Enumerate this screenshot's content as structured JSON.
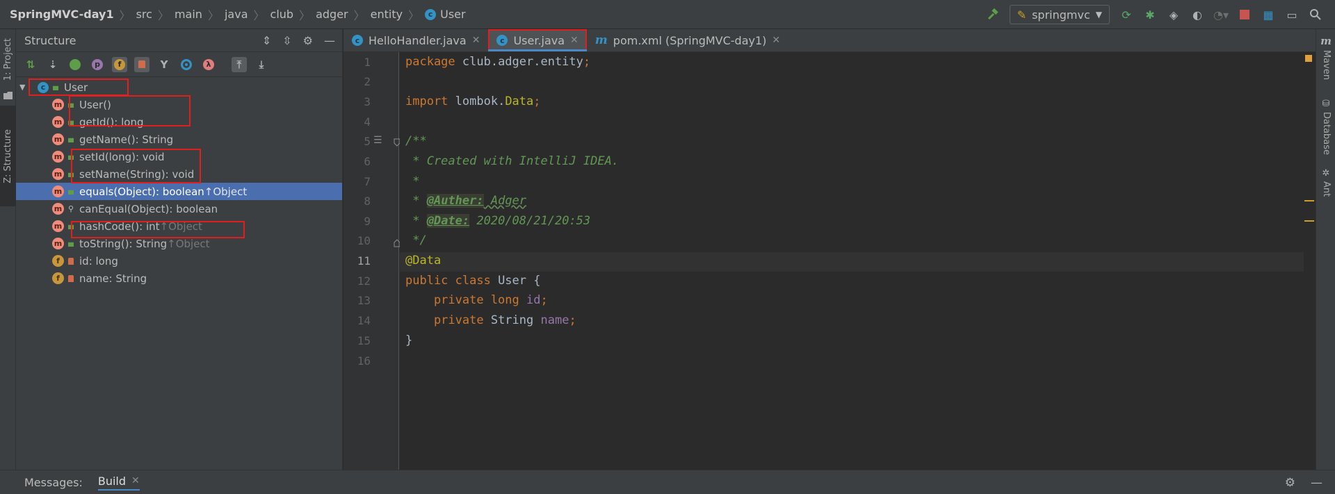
{
  "breadcrumb": {
    "items": [
      "SpringMVC-day1",
      "src",
      "main",
      "java",
      "club",
      "adger",
      "entity",
      "User"
    ],
    "class_badge": "c"
  },
  "toolbar": {
    "run_config_label": "springmvc",
    "icons": [
      "hammer-icon",
      "run-config-dropdown",
      "rerun-icon",
      "debug-icon",
      "coverage-icon",
      "profile-icon",
      "stop-icon",
      "project-structure-icon",
      "layout-icon",
      "search-everywhere-icon"
    ]
  },
  "left_strip": {
    "project_label": "1: Project",
    "structure_label": "Z: Structure"
  },
  "structure_panel": {
    "title": "Structure",
    "toolbar_badges": {
      "f": "f",
      "p": "p",
      "lambda": "λ",
      "anon": "a"
    },
    "root": {
      "badge": "c",
      "label": "User"
    },
    "method_badge": "m",
    "field_badge": "f",
    "items": [
      {
        "kind": "method",
        "vis": "public",
        "label": "User()",
        "inherited": ""
      },
      {
        "kind": "method",
        "vis": "public",
        "label": "getId(): long",
        "inherited": ""
      },
      {
        "kind": "method",
        "vis": "public",
        "label": "getName(): String",
        "inherited": ""
      },
      {
        "kind": "method",
        "vis": "public",
        "label": "setId(long): void",
        "inherited": ""
      },
      {
        "kind": "method",
        "vis": "public",
        "label": "setName(String): void",
        "inherited": ""
      },
      {
        "kind": "method",
        "vis": "public",
        "label": "equals(Object): boolean ",
        "inherited": "↑Object"
      },
      {
        "kind": "method",
        "vis": "package",
        "label": "canEqual(Object): boolean",
        "inherited": ""
      },
      {
        "kind": "method",
        "vis": "public",
        "label": "hashCode(): int ",
        "inherited": "↑Object"
      },
      {
        "kind": "method",
        "vis": "public",
        "label": "toString(): String ",
        "inherited": "↑Object"
      },
      {
        "kind": "field",
        "vis": "private",
        "label": "id: long",
        "inherited": ""
      },
      {
        "kind": "field",
        "vis": "private",
        "label": "name: String",
        "inherited": ""
      }
    ],
    "selected_index": 5
  },
  "tabs": [
    {
      "icon": "c",
      "label": "HelloHandler.java",
      "active": false
    },
    {
      "icon": "c",
      "label": "User.java",
      "active": true
    },
    {
      "icon": "m",
      "label": "pom.xml (SpringMVC-day1)",
      "active": false
    }
  ],
  "editor": {
    "current_line": 11,
    "line_numbers": [
      "1",
      "2",
      "3",
      "4",
      "5",
      "6",
      "7",
      "8",
      "9",
      "10",
      "11",
      "12",
      "13",
      "14",
      "15",
      "16"
    ],
    "code": {
      "l1_kw": "package",
      "l1_rest": " club.adger.entity",
      "l1_semi": ";",
      "l3_kw": "import",
      "l3_pkg": " lombok.",
      "l3_cls": "Data",
      "l3_semi": ";",
      "l5": "/**",
      "l6": " * Created with IntelliJ IDEA.",
      "l7": " *",
      "l8_pre": " * ",
      "l8_tag": "@Auther:",
      "l8_val": " Adger",
      "l9_pre": " * ",
      "l9_tag": "@Date:",
      "l9_val": " 2020/08/21/20:53",
      "l10": " */",
      "l11": "@Data",
      "l12_kw": "public class",
      "l12_rest": " User {",
      "l13_kw": "    private long",
      "l13_field": " id",
      "l13_semi": ";",
      "l14_kw": "    private",
      "l14_type": " String",
      "l14_field": " name",
      "l14_semi": ";",
      "l15": "}"
    }
  },
  "right_strip": {
    "maven_badge": "m",
    "maven_label": "Maven",
    "database_label": "Database",
    "ant_label": "Ant"
  },
  "bottom_bar": {
    "messages_label": "Messages:",
    "build_tab_label": "Build"
  },
  "colors": {
    "accent": "#4a88c7",
    "selection": "#4b6eaf",
    "highlight_box": "#e01f1f"
  }
}
